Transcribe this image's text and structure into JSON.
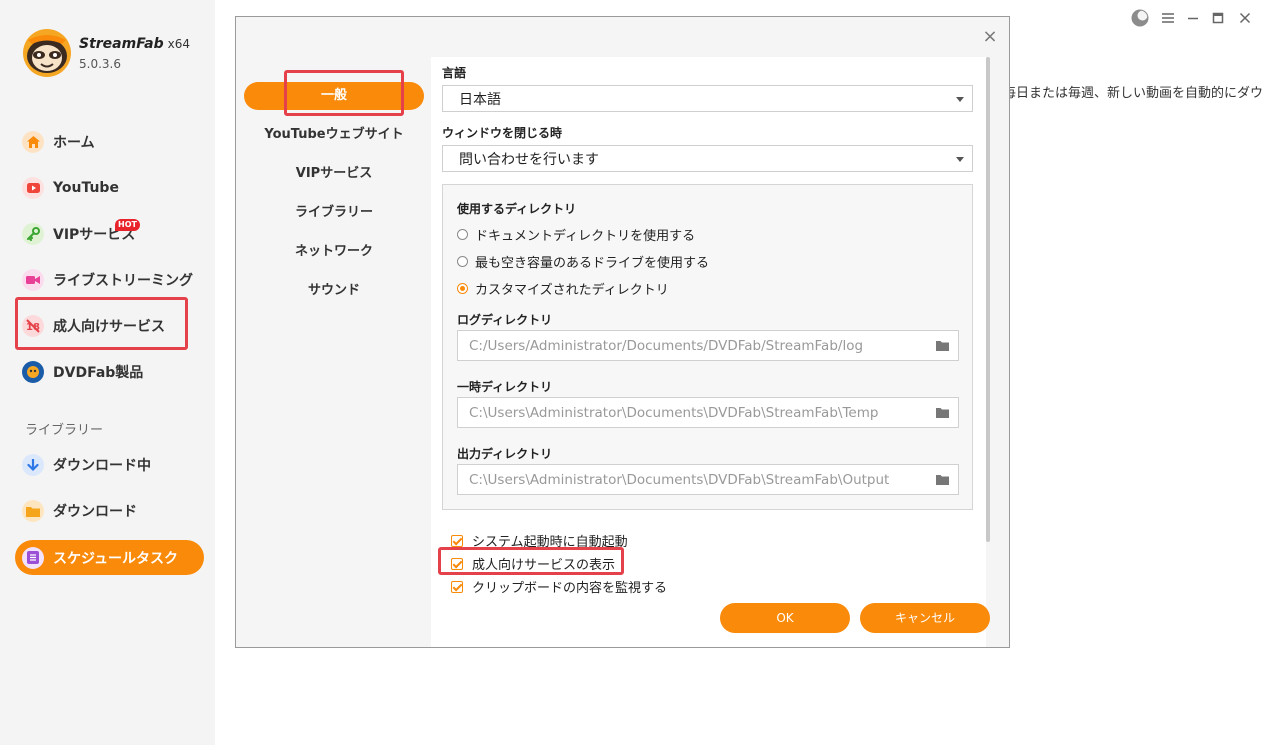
{
  "app": {
    "brand": "StreamFab",
    "arch": "x64",
    "version": "5.0.3.6"
  },
  "sidebar": {
    "items": [
      {
        "label": "ホーム"
      },
      {
        "label": "YouTube"
      },
      {
        "label": "VIPサービス",
        "badge": "HOT"
      },
      {
        "label": "ライブストリーミング"
      },
      {
        "label": "成人向けサービス"
      },
      {
        "label": "DVDFab製品"
      }
    ],
    "library_heading": "ライブラリー",
    "library_items": [
      {
        "label": "ダウンロード中"
      },
      {
        "label": "ダウンロード"
      },
      {
        "label": "スケジュールタスク"
      }
    ]
  },
  "background": {
    "text_right": "毎日または毎週、新しい動画を自動的にダウ"
  },
  "dialog": {
    "close_glyph": "×",
    "tabs": [
      "一般",
      "YouTubeウェブサイト",
      "VIPサービス",
      "ライブラリー",
      "ネットワーク",
      "サウンド"
    ],
    "language": {
      "label": "言語",
      "value": "日本語"
    },
    "on_close": {
      "label": "ウィンドウを閉じる時",
      "value": "問い合わせを行います"
    },
    "directory": {
      "label": "使用するディレクトリ",
      "options": [
        {
          "label": "ドキュメントディレクトリを使用する",
          "checked": false
        },
        {
          "label": "最も空き容量のあるドライブを使用する",
          "checked": false
        },
        {
          "label": "カスタマイズされたディレクトリ",
          "checked": true
        }
      ],
      "log": {
        "label": "ログディレクトリ",
        "path": "C:/Users/Administrator/Documents/DVDFab/StreamFab/log"
      },
      "temp": {
        "label": "一時ディレクトリ",
        "path": "C:\\Users\\Administrator\\Documents\\DVDFab\\StreamFab\\Temp"
      },
      "output": {
        "label": "出力ディレクトリ",
        "path": "C:\\Users\\Administrator\\Documents\\DVDFab\\StreamFab\\Output"
      }
    },
    "checkboxes": [
      {
        "label": "システム起動時に自動起動",
        "checked": true
      },
      {
        "label": "成人向けサービスの表示",
        "checked": true
      },
      {
        "label": "クリップボードの内容を監視する",
        "checked": true
      }
    ],
    "ok_label": "OK",
    "cancel_label": "キャンセル"
  },
  "colors": {
    "accent": "#f98a0a",
    "highlight": "#e5414a"
  }
}
